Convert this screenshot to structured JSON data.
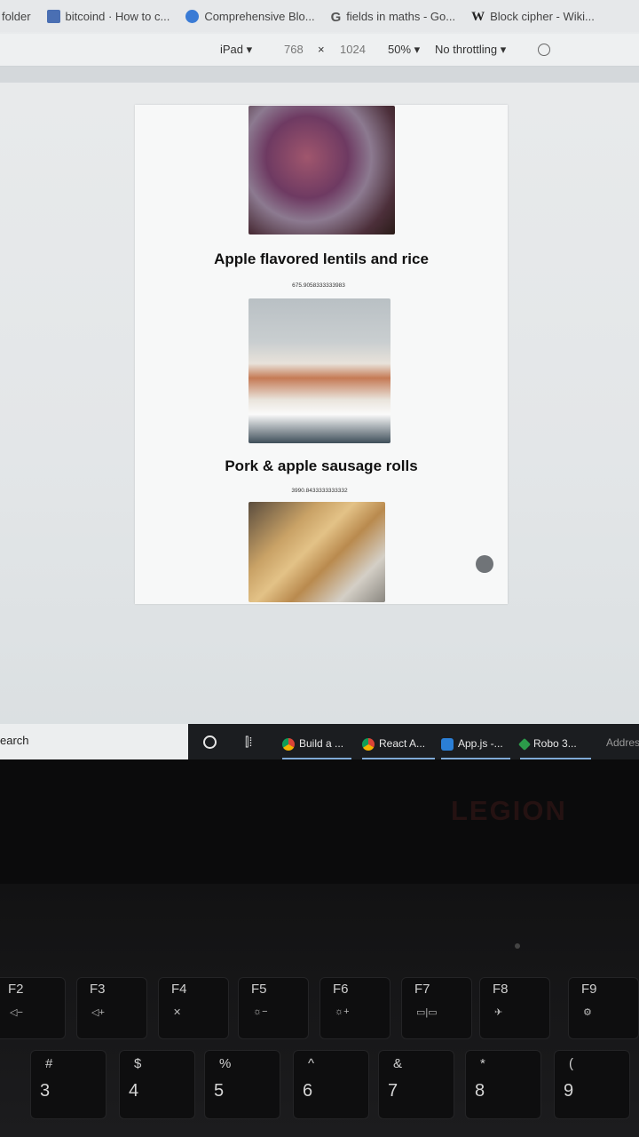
{
  "bookmarks": [
    {
      "label": "folder"
    },
    {
      "label": "bitcoind · How to c..."
    },
    {
      "label": "Comprehensive Blo..."
    },
    {
      "label": "fields in maths - Go..."
    },
    {
      "label": "Block cipher - Wiki..."
    }
  ],
  "device_toolbar": {
    "device": "iPad ▾",
    "width": "768",
    "times": "×",
    "height": "1024",
    "zoom": "50% ▾",
    "throttling": "No throttling ▾"
  },
  "recipes": [
    {
      "title": "Apple flavored lentils and rice",
      "price": "675.9058333333983"
    },
    {
      "title": "Pork & apple sausage rolls",
      "price": "3990.8433333333332"
    }
  ],
  "taskbar": {
    "search_placeholder": "earch",
    "tasks": [
      {
        "label": "Build a ..."
      },
      {
        "label": "React A..."
      },
      {
        "label": "App.js -..."
      },
      {
        "label": "Robo 3..."
      }
    ],
    "address": "Addres"
  },
  "laptop": {
    "brand": "LEGION",
    "fn_keys": [
      {
        "label": "F2",
        "sub": "◁−"
      },
      {
        "label": "F3",
        "sub": "◁+"
      },
      {
        "label": "F4",
        "sub": "✕"
      },
      {
        "label": "F5",
        "sub": "☼−"
      },
      {
        "label": "F6",
        "sub": "☼+"
      },
      {
        "label": "F7",
        "sub": "▭|▭"
      },
      {
        "label": "F8",
        "sub": "✈"
      },
      {
        "label": "F9",
        "sub": "⚙"
      }
    ],
    "num_keys": [
      {
        "top": "#",
        "main": "3"
      },
      {
        "top": "$",
        "main": "4"
      },
      {
        "top": "%",
        "main": "5"
      },
      {
        "top": "^",
        "main": "6"
      },
      {
        "top": "&",
        "main": "7"
      },
      {
        "top": "*",
        "main": "8"
      },
      {
        "top": "(",
        "main": "9"
      }
    ]
  }
}
